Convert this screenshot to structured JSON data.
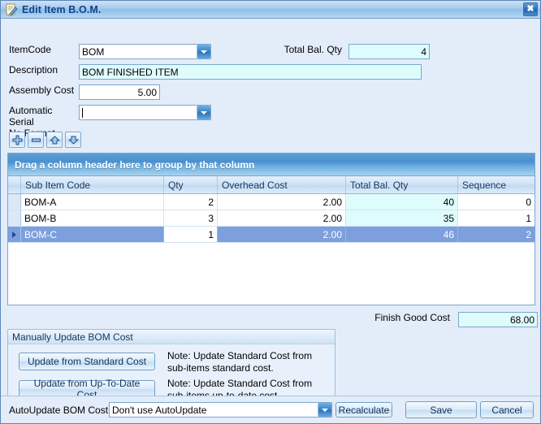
{
  "window": {
    "title": "Edit Item B.O.M.",
    "icon": "edit-document-icon",
    "close_label": "✖",
    "accent_color": "#2f6fb5",
    "body_bg": "#e3ecf9",
    "readonly_field_bg": "#dffcfc",
    "selection_color": "#7d9fdd"
  },
  "form": {
    "itemcode": {
      "label": "ItemCode",
      "value": "BOM"
    },
    "description": {
      "label": "Description",
      "value": "BOM FINISHED ITEM"
    },
    "assembly_cost": {
      "label": "Assembly Cost",
      "value": "5.00"
    },
    "serial_format": {
      "label": "Automatic Serial\nNo Format",
      "label_line1": "Automatic Serial",
      "label_line2": "No Format",
      "value": ""
    },
    "total_bal_qty": {
      "label": "Total Bal. Qty",
      "value": "4"
    }
  },
  "toolbar": {
    "buttons": [
      {
        "name": "add-row-button",
        "icon": "plus-icon",
        "glyph": "+"
      },
      {
        "name": "delete-row-button",
        "icon": "minus-icon",
        "glyph": "−"
      },
      {
        "name": "move-up-button",
        "icon": "arrow-up-icon",
        "glyph": "▲"
      },
      {
        "name": "move-down-button",
        "icon": "arrow-down-icon",
        "glyph": "▼"
      }
    ]
  },
  "grid": {
    "group_panel_text": "Drag a column header here to group by that column",
    "columns": [
      "Sub Item Code",
      "Qty",
      "Overhead Cost",
      "Total Bal. Qty",
      "Sequence"
    ],
    "rows": [
      {
        "sub_item_code": "BOM-A",
        "qty": "2",
        "overhead_cost": "2.00",
        "total_bal_qty": "40",
        "sequence": "0",
        "selected": false
      },
      {
        "sub_item_code": "BOM-B",
        "qty": "3",
        "overhead_cost": "2.00",
        "total_bal_qty": "35",
        "sequence": "1",
        "selected": false
      },
      {
        "sub_item_code": "BOM-C",
        "qty": "1",
        "overhead_cost": "2.00",
        "total_bal_qty": "46",
        "sequence": "2",
        "selected": true
      }
    ]
  },
  "finish_good_cost": {
    "label": "Finish Good Cost",
    "value": "68.00"
  },
  "manual_update": {
    "caption": "Manually Update BOM Cost",
    "standard_button": "Update from Standard Cost",
    "standard_note": "Note: Update Standard Cost from sub-items standard cost.",
    "uptodate_button": "Update from Up-To-Date Cost",
    "uptodate_note": "Note: Update Standard Cost from sub-items up-to-date cost."
  },
  "bottom": {
    "autoupdate_label": "AutoUpdate BOM Cost:",
    "autoupdate_value": "Don't use AutoUpdate",
    "recalculate": "Recalculate",
    "save": "Save",
    "cancel": "Cancel"
  }
}
